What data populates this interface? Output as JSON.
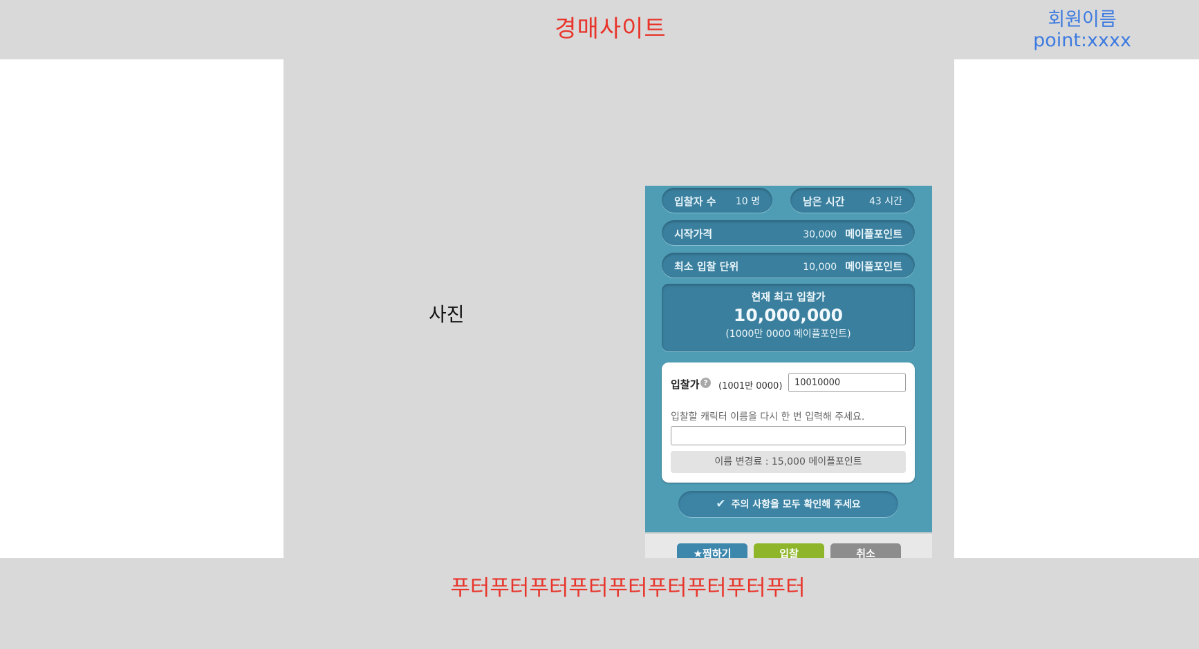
{
  "header": {
    "site_title": "경매사이트",
    "user_name": "회원이름",
    "points": "point:xxxx"
  },
  "main": {
    "photo_label": "사진"
  },
  "auction": {
    "bidders_label": "입찰자 수",
    "bidders_value": "10 명",
    "time_left_label": "남은 시간",
    "time_left_value": "43 시간",
    "start_price_label": "시작가격",
    "start_price_value": "30,000",
    "start_price_unit": "메이플포인트",
    "min_increment_label": "최소 입찰 단위",
    "min_increment_value": "10,000",
    "min_increment_unit": "메이플포인트",
    "current_bid_title": "현재 최고 입찰가",
    "current_bid_amount": "10,000,000",
    "current_bid_readable": "(1000만 0000 메이플포인트)",
    "bid_price_label": "입찰가",
    "help_icon_glyph": "?",
    "bid_price_hint": "(1001만 0000)",
    "bid_price_value": "10010000",
    "name_prompt": "입찰할 캐릭터 이름을 다시 한 번 입력해 주세요.",
    "name_value": "",
    "name_change_fee": "이름 변경료 : 15,000 메이플포인트",
    "notice_button": "주의 사항을 모두 확인해 주세요",
    "wish_button": "찜하기",
    "bid_button": "입찰",
    "cancel_button": "취소"
  },
  "footer": {
    "text": "푸터푸터푸터푸터푸터푸터푸터푸터푸터"
  },
  "colors": {
    "accent_red": "#e8352b",
    "accent_blue": "#3d7be0",
    "panel_teal": "#4e9db5",
    "bid_green": "#8fb62a"
  }
}
